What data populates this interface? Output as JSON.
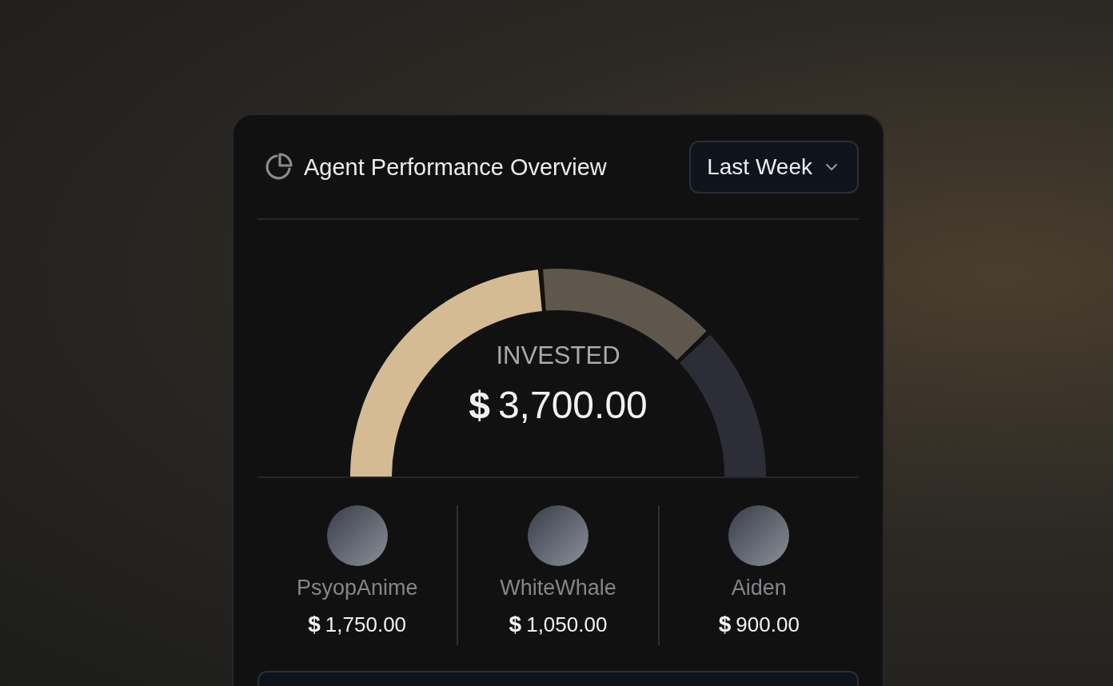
{
  "card": {
    "title": "Agent Performance Overview",
    "period": "Last Week"
  },
  "gauge": {
    "label": "INVESTED",
    "currency": "$",
    "total": "3,700.00",
    "chart_data": {
      "type": "donut",
      "values": [
        47.3,
        28.4,
        24.3
      ]
    }
  },
  "agents": [
    {
      "name": "PsyopAnime",
      "currency": "$",
      "amount": "1,750.00",
      "color": "#d5bb93"
    },
    {
      "name": "WhiteWhale",
      "currency": "$",
      "amount": "1,050.00",
      "color": "#5f574b"
    },
    {
      "name": "Aiden",
      "currency": "$",
      "amount": "900.00",
      "color": "#2c2d37"
    }
  ]
}
